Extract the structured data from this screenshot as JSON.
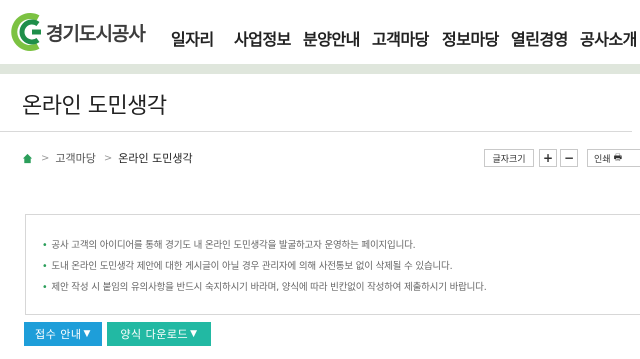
{
  "site": {
    "logo_text": "경기도시공사"
  },
  "nav": [
    {
      "label": "일자리"
    },
    {
      "label": "사업정보"
    },
    {
      "label": "분양안내"
    },
    {
      "label": "고객마당"
    },
    {
      "label": "정보마당"
    },
    {
      "label": "열린경영"
    },
    {
      "label": "공사소개"
    }
  ],
  "page": {
    "title": "온라인 도민생각"
  },
  "breadcrumb": {
    "items": [
      "고객마당",
      "온라인 도민생각"
    ]
  },
  "tools": {
    "font_size": "글자크기",
    "plus": "+",
    "minus": "−",
    "print": "인쇄"
  },
  "notice": [
    "공사 고객의 아이디어를 통해 경기도 내 온라인 도민생각을 발굴하고자 운영하는 페이지입니다.",
    "도내 온라인 도민생각 제안에 대한 게시글이 아닐 경우 관리자에 의해 사전통보 없이 삭제될 수 있습니다.",
    "제안 작성 시 붙임의 유의사항을 반드시 숙지하시기 바라며, 양식에 따라 빈칸없이 작성하여 제출하시기 바랍니다."
  ],
  "buttons": {
    "guide": "접수 안내",
    "form_download": "양식 다운로드"
  },
  "colors": {
    "brand_green": "#2b9e5a",
    "blue_button": "#1e9ed9",
    "teal_button": "#22b9a3",
    "nav_underline": "#dfe6dc"
  }
}
